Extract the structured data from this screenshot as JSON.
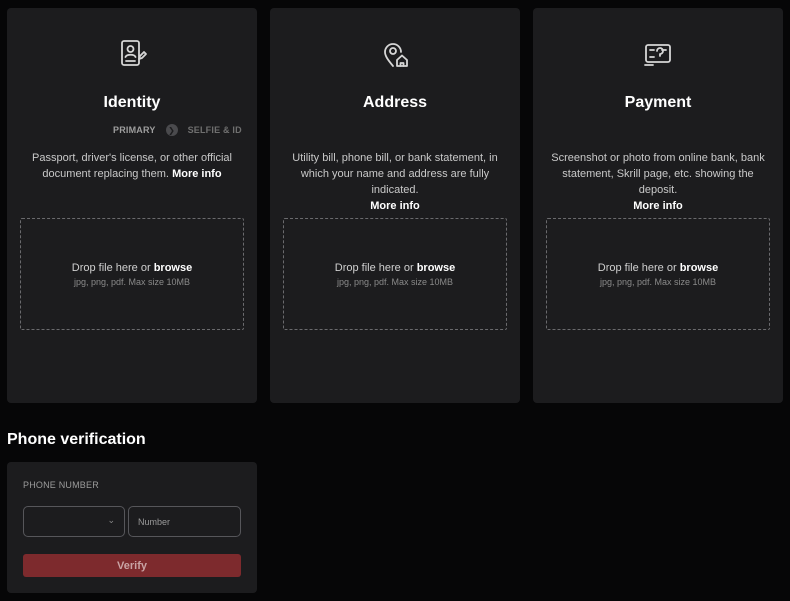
{
  "cards": [
    {
      "icon": "id-card-icon",
      "title": "Identity",
      "steps": [
        "PRIMARY",
        "SELFIE & ID"
      ],
      "description": "Passport, driver's license, or other official document replacing them.",
      "more_info": "More info",
      "drop_text": "Drop file here or",
      "browse": "browse",
      "hint": "jpg, png, pdf. Max size 10MB"
    },
    {
      "icon": "location-home-icon",
      "title": "Address",
      "description": "Utility bill, phone bill, or bank statement, in which your name and address are fully indicated.",
      "more_info": "More info",
      "drop_text": "Drop file here or",
      "browse": "browse",
      "hint": "jpg, png, pdf. Max size 10MB"
    },
    {
      "icon": "payment-card-icon",
      "title": "Payment",
      "description": "Screenshot or photo from online bank, bank statement, Skrill page, etc. showing the deposit.",
      "more_info": "More info",
      "drop_text": "Drop file here or",
      "browse": "browse",
      "hint": "jpg, png, pdf. Max size 10MB"
    }
  ],
  "phone": {
    "title": "Phone verification",
    "label": "PHONE NUMBER",
    "country_value": "",
    "number_placeholder": "Number",
    "verify_label": "Verify"
  },
  "colors": {
    "background": "#060607",
    "card": "#1c1c1e",
    "accent_button": "#7d2a2d"
  }
}
